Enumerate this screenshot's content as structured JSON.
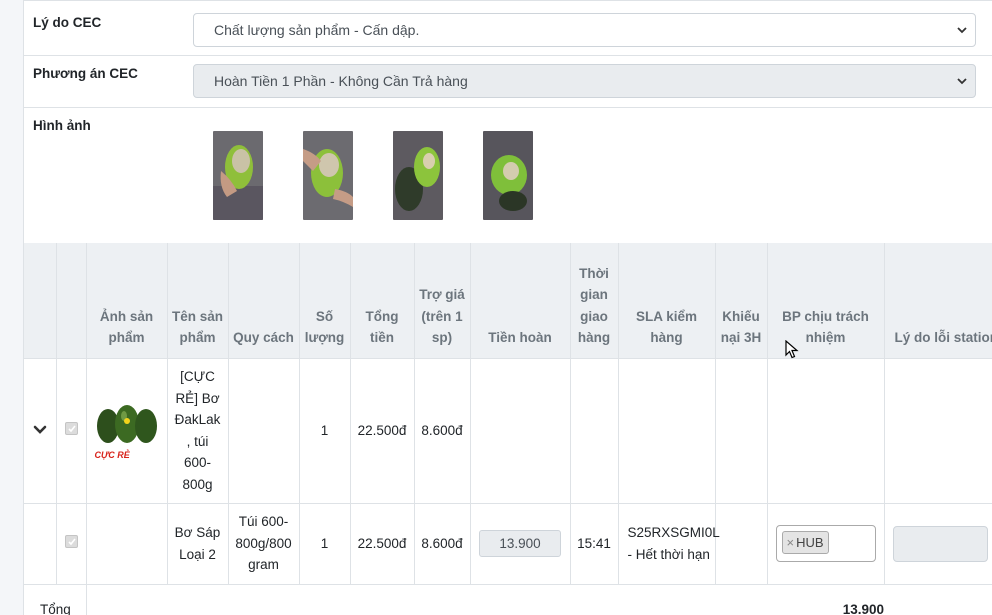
{
  "form": {
    "reason_label": "Lý do CEC",
    "reason_value": "Chất lượng sản phẩm - Cấn dập.",
    "plan_label": "Phương án CEC",
    "plan_value": "Hoàn Tiền 1 Phần - Không Cần Trả hàng",
    "images_label": "Hình ảnh"
  },
  "table": {
    "headers": {
      "image": "Ảnh sản phẩm",
      "name": "Tên sản phẩm",
      "spec": "Quy cách",
      "qty": "Số lượng",
      "total": "Tổng tiền",
      "subsidy": "Trợ giá (trên 1 sp)",
      "refund": "Tiền hoàn",
      "delivery_time": "Thời gian giao hàng",
      "sla": "SLA kiểm hàng",
      "complaint": "Khiếu nại 3H",
      "dept": "BP chịu trách nhiệm",
      "station_reason": "Lý do lỗi station"
    },
    "product_row": {
      "name": "[CỰC RẺ] Bơ ĐakLak , túi 600-800g",
      "image_badge": "CỰC RẺ",
      "qty": "1",
      "total": "22.500đ",
      "subsidy": "8.600đ"
    },
    "sub_row": {
      "name": "Bơ Sáp Loại 2",
      "spec": "Túi 600-800g/800 gram",
      "qty": "1",
      "total": "22.500đ",
      "subsidy": "8.600đ",
      "refund": "13.900",
      "delivery_time": "15:41",
      "sla": "S25RXSGMI0L - Hết thời hạn",
      "dept_tag": "HUB",
      "dept_tag_remove": "×"
    },
    "total_row": {
      "label": "Tổng",
      "value": "13.900"
    }
  },
  "colors": {
    "header_bg": "#edf0f3",
    "disabled_bg": "#e9ecef",
    "border": "#dee2e6"
  }
}
